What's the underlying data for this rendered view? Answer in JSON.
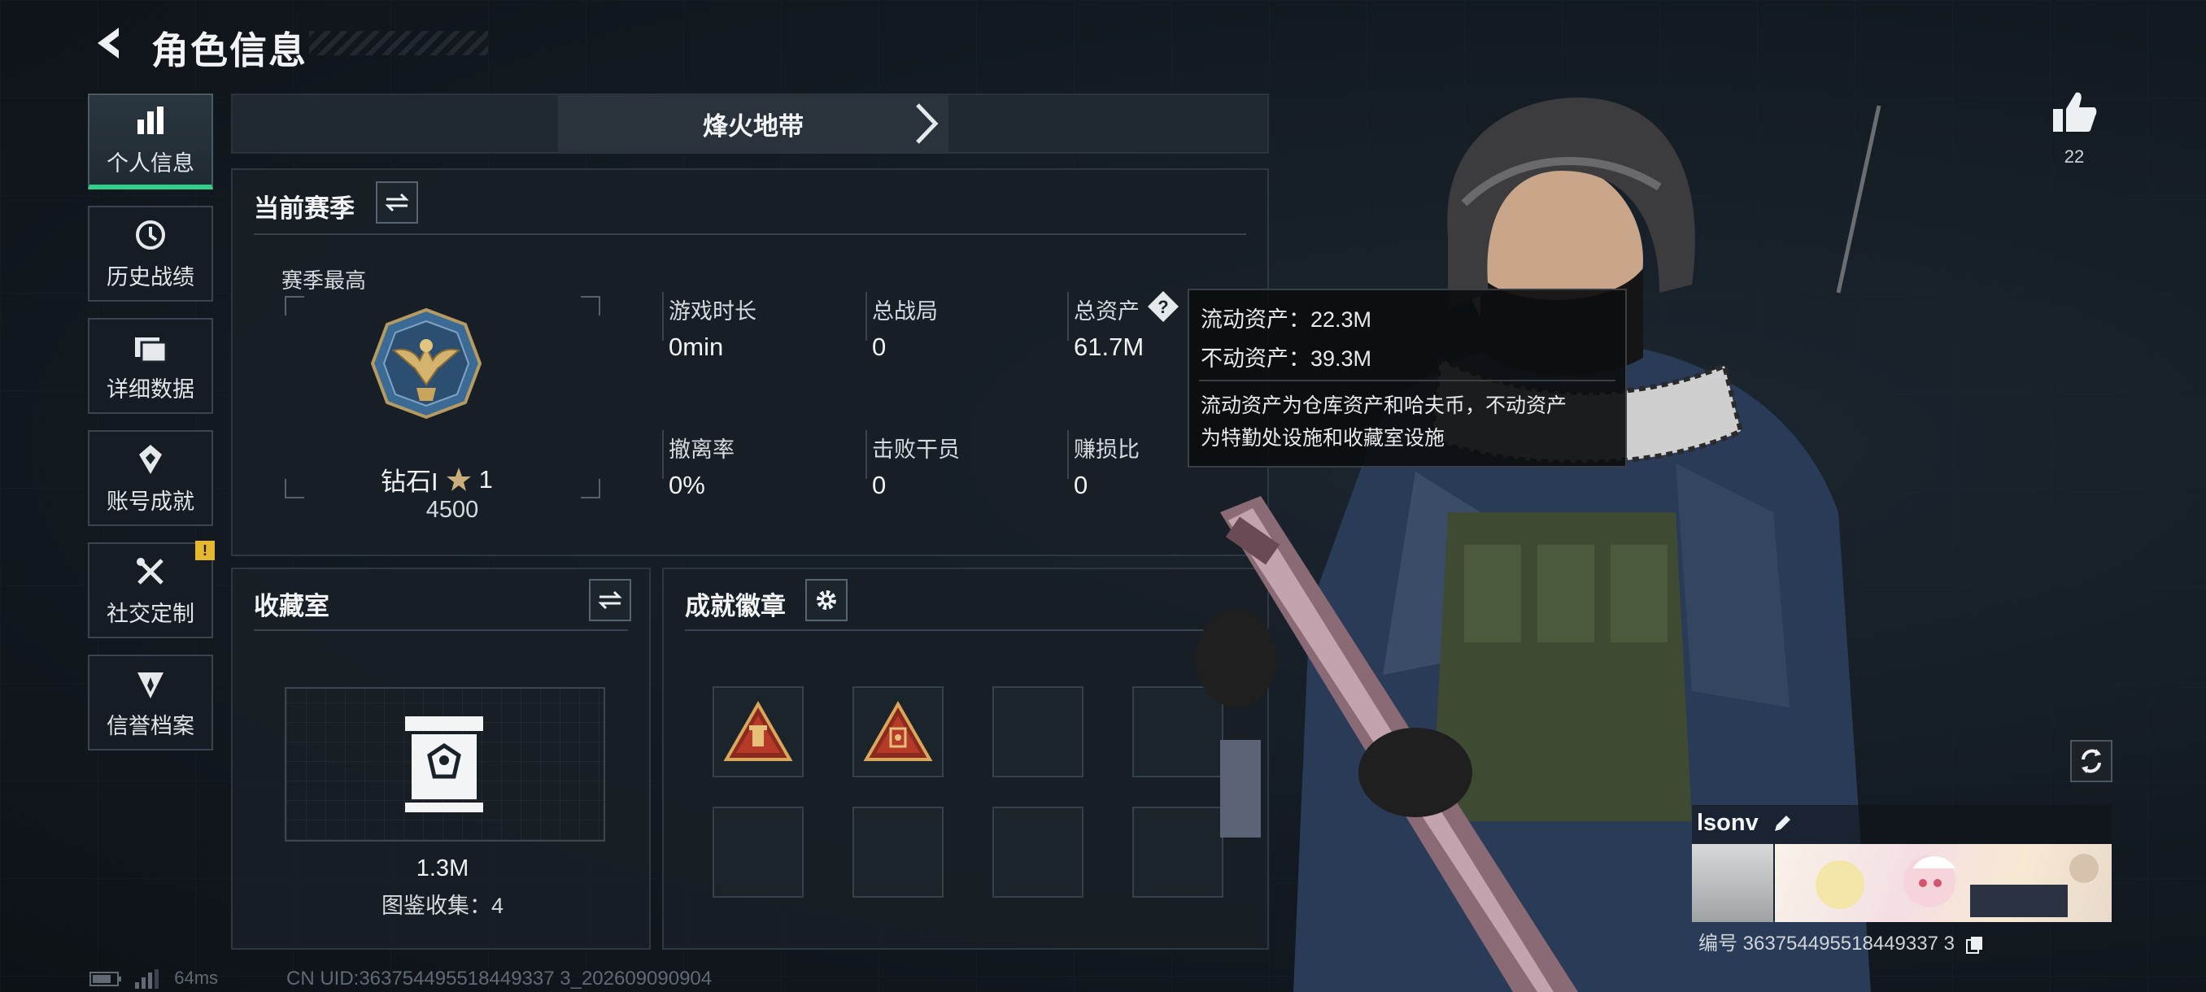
{
  "header": {
    "title": "角色信息"
  },
  "nav": {
    "items": [
      {
        "label": "个人信息",
        "icon": "bar-chart-icon"
      },
      {
        "label": "历史战绩",
        "icon": "history-icon"
      },
      {
        "label": "详细数据",
        "icon": "folder-icon"
      },
      {
        "label": "账号成就",
        "icon": "achievement-icon"
      },
      {
        "label": "社交定制",
        "icon": "tools-icon",
        "warning": "!"
      },
      {
        "label": "信誉档案",
        "icon": "reputation-icon"
      }
    ]
  },
  "mode": {
    "name": "烽火地带"
  },
  "season": {
    "title": "当前赛季",
    "best_label": "赛季最高",
    "rank": "钻石I",
    "rank_stars": "1",
    "rank_points": "4500",
    "stats": [
      {
        "label": "游戏时长",
        "value": "0min"
      },
      {
        "label": "总战局",
        "value": "0"
      },
      {
        "label": "总资产",
        "value": "61.7M"
      },
      {
        "label": "撤离率",
        "value": "0%"
      },
      {
        "label": "击败干员",
        "value": "0"
      },
      {
        "label": "赚损比",
        "value": "0"
      }
    ]
  },
  "tooltip": {
    "liquid": "流动资产：22.3M",
    "fixed": "不动资产：39.3M",
    "desc_line1": "流动资产为仓库资产和哈夫币，不动资产",
    "desc_line2": "为特勤处设施和收藏室设施"
  },
  "collection": {
    "title": "收藏室",
    "value": "1.3M",
    "count_label": "图鉴收集：4"
  },
  "badges": {
    "title": "成就徽章",
    "filled_count": 2,
    "total_slots": 8
  },
  "profile": {
    "likes": "22",
    "name": "lsonv",
    "id_label": "编号 363754495518449337 3"
  },
  "status_bar": {
    "ping": "64ms",
    "uid": "CN UID:363754495518449337 3_202609090904"
  },
  "colors": {
    "accent": "#2fd08a",
    "warning": "#e6b62c"
  }
}
